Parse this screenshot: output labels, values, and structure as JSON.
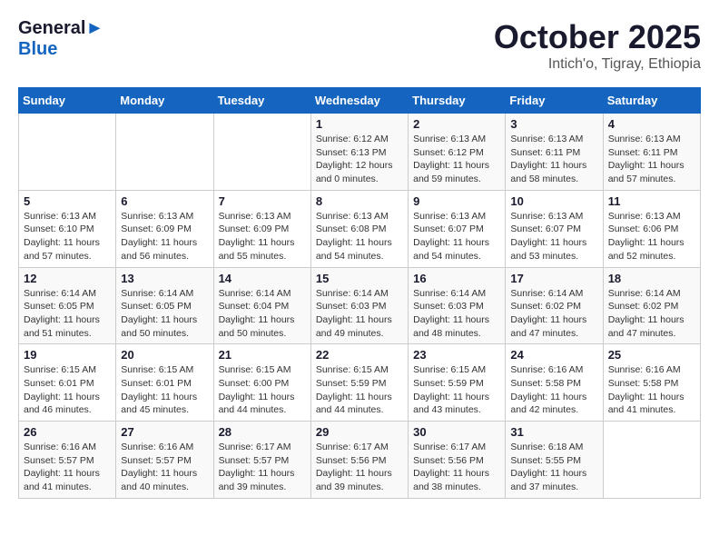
{
  "header": {
    "logo_line1": "General",
    "logo_line2": "Blue",
    "month_title": "October 2025",
    "subtitle": "Intich'o, Tigray, Ethiopia"
  },
  "weekdays": [
    "Sunday",
    "Monday",
    "Tuesday",
    "Wednesday",
    "Thursday",
    "Friday",
    "Saturday"
  ],
  "weeks": [
    [
      {
        "day": "",
        "info": ""
      },
      {
        "day": "",
        "info": ""
      },
      {
        "day": "",
        "info": ""
      },
      {
        "day": "1",
        "info": "Sunrise: 6:12 AM\nSunset: 6:13 PM\nDaylight: 12 hours\nand 0 minutes."
      },
      {
        "day": "2",
        "info": "Sunrise: 6:13 AM\nSunset: 6:12 PM\nDaylight: 11 hours\nand 59 minutes."
      },
      {
        "day": "3",
        "info": "Sunrise: 6:13 AM\nSunset: 6:11 PM\nDaylight: 11 hours\nand 58 minutes."
      },
      {
        "day": "4",
        "info": "Sunrise: 6:13 AM\nSunset: 6:11 PM\nDaylight: 11 hours\nand 57 minutes."
      }
    ],
    [
      {
        "day": "5",
        "info": "Sunrise: 6:13 AM\nSunset: 6:10 PM\nDaylight: 11 hours\nand 57 minutes."
      },
      {
        "day": "6",
        "info": "Sunrise: 6:13 AM\nSunset: 6:09 PM\nDaylight: 11 hours\nand 56 minutes."
      },
      {
        "day": "7",
        "info": "Sunrise: 6:13 AM\nSunset: 6:09 PM\nDaylight: 11 hours\nand 55 minutes."
      },
      {
        "day": "8",
        "info": "Sunrise: 6:13 AM\nSunset: 6:08 PM\nDaylight: 11 hours\nand 54 minutes."
      },
      {
        "day": "9",
        "info": "Sunrise: 6:13 AM\nSunset: 6:07 PM\nDaylight: 11 hours\nand 54 minutes."
      },
      {
        "day": "10",
        "info": "Sunrise: 6:13 AM\nSunset: 6:07 PM\nDaylight: 11 hours\nand 53 minutes."
      },
      {
        "day": "11",
        "info": "Sunrise: 6:13 AM\nSunset: 6:06 PM\nDaylight: 11 hours\nand 52 minutes."
      }
    ],
    [
      {
        "day": "12",
        "info": "Sunrise: 6:14 AM\nSunset: 6:05 PM\nDaylight: 11 hours\nand 51 minutes."
      },
      {
        "day": "13",
        "info": "Sunrise: 6:14 AM\nSunset: 6:05 PM\nDaylight: 11 hours\nand 50 minutes."
      },
      {
        "day": "14",
        "info": "Sunrise: 6:14 AM\nSunset: 6:04 PM\nDaylight: 11 hours\nand 50 minutes."
      },
      {
        "day": "15",
        "info": "Sunrise: 6:14 AM\nSunset: 6:03 PM\nDaylight: 11 hours\nand 49 minutes."
      },
      {
        "day": "16",
        "info": "Sunrise: 6:14 AM\nSunset: 6:03 PM\nDaylight: 11 hours\nand 48 minutes."
      },
      {
        "day": "17",
        "info": "Sunrise: 6:14 AM\nSunset: 6:02 PM\nDaylight: 11 hours\nand 47 minutes."
      },
      {
        "day": "18",
        "info": "Sunrise: 6:14 AM\nSunset: 6:02 PM\nDaylight: 11 hours\nand 47 minutes."
      }
    ],
    [
      {
        "day": "19",
        "info": "Sunrise: 6:15 AM\nSunset: 6:01 PM\nDaylight: 11 hours\nand 46 minutes."
      },
      {
        "day": "20",
        "info": "Sunrise: 6:15 AM\nSunset: 6:01 PM\nDaylight: 11 hours\nand 45 minutes."
      },
      {
        "day": "21",
        "info": "Sunrise: 6:15 AM\nSunset: 6:00 PM\nDaylight: 11 hours\nand 44 minutes."
      },
      {
        "day": "22",
        "info": "Sunrise: 6:15 AM\nSunset: 5:59 PM\nDaylight: 11 hours\nand 44 minutes."
      },
      {
        "day": "23",
        "info": "Sunrise: 6:15 AM\nSunset: 5:59 PM\nDaylight: 11 hours\nand 43 minutes."
      },
      {
        "day": "24",
        "info": "Sunrise: 6:16 AM\nSunset: 5:58 PM\nDaylight: 11 hours\nand 42 minutes."
      },
      {
        "day": "25",
        "info": "Sunrise: 6:16 AM\nSunset: 5:58 PM\nDaylight: 11 hours\nand 41 minutes."
      }
    ],
    [
      {
        "day": "26",
        "info": "Sunrise: 6:16 AM\nSunset: 5:57 PM\nDaylight: 11 hours\nand 41 minutes."
      },
      {
        "day": "27",
        "info": "Sunrise: 6:16 AM\nSunset: 5:57 PM\nDaylight: 11 hours\nand 40 minutes."
      },
      {
        "day": "28",
        "info": "Sunrise: 6:17 AM\nSunset: 5:57 PM\nDaylight: 11 hours\nand 39 minutes."
      },
      {
        "day": "29",
        "info": "Sunrise: 6:17 AM\nSunset: 5:56 PM\nDaylight: 11 hours\nand 39 minutes."
      },
      {
        "day": "30",
        "info": "Sunrise: 6:17 AM\nSunset: 5:56 PM\nDaylight: 11 hours\nand 38 minutes."
      },
      {
        "day": "31",
        "info": "Sunrise: 6:18 AM\nSunset: 5:55 PM\nDaylight: 11 hours\nand 37 minutes."
      },
      {
        "day": "",
        "info": ""
      }
    ]
  ]
}
